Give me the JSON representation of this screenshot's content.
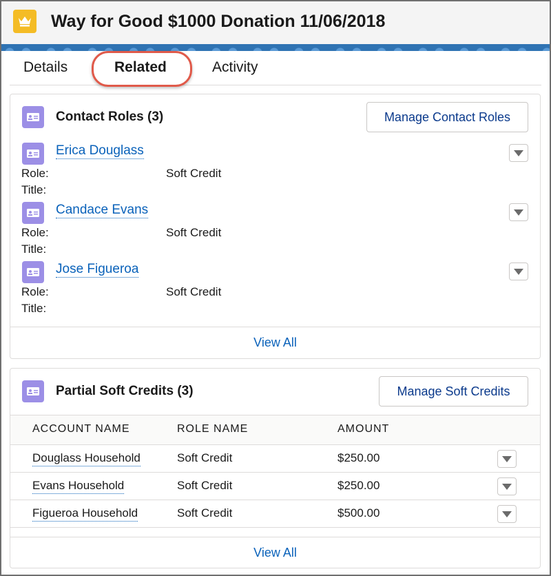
{
  "header": {
    "title": "Way for Good $1000 Donation 11/06/2018",
    "icon": "crown-icon",
    "icon_color": "#f4bc25"
  },
  "tabs": [
    {
      "label": "Details"
    },
    {
      "label": "Related",
      "active": true
    },
    {
      "label": "Activity"
    }
  ],
  "contact_roles": {
    "title": "Contact Roles (3)",
    "button": "Manage Contact Roles",
    "role_label": "Role:",
    "title_label": "Title:",
    "items": [
      {
        "name": "Erica Douglass",
        "role": "Soft Credit",
        "title": ""
      },
      {
        "name": "Candace Evans",
        "role": "Soft Credit",
        "title": ""
      },
      {
        "name": "Jose Figueroa",
        "role": "Soft Credit",
        "title": ""
      }
    ],
    "footer": "View All"
  },
  "soft_credits": {
    "title": "Partial Soft Credits (3)",
    "button": "Manage Soft Credits",
    "columns": [
      "ACCOUNT NAME",
      "ROLE NAME",
      "AMOUNT"
    ],
    "rows": [
      {
        "account": "Douglass Household",
        "role": "Soft Credit",
        "amount": "$250.00"
      },
      {
        "account": "Evans Household",
        "role": "Soft Credit",
        "amount": "$250.00"
      },
      {
        "account": "Figueroa Household",
        "role": "Soft Credit",
        "amount": "$500.00"
      }
    ],
    "footer": "View All"
  },
  "colors": {
    "link": "#0a62ba",
    "contact_icon": "#9c8fe6",
    "highlight_ring": "#e05a4a"
  }
}
